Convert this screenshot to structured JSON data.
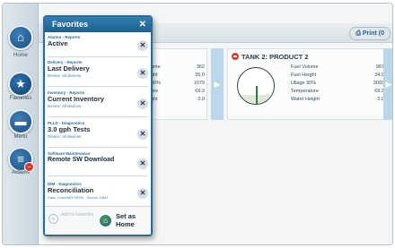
{
  "topbar": {
    "print_label": "⎙ Print (0"
  },
  "sidebar": {
    "items": [
      {
        "label": "Home"
      },
      {
        "label": "Favorites"
      },
      {
        "label": "Menu"
      },
      {
        "label": "Actions"
      }
    ]
  },
  "tank1": {
    "readings": [
      {
        "value": "362"
      },
      {
        "value": "35.0"
      },
      {
        "value": "1079"
      },
      {
        "value": "69.3"
      },
      {
        "value": "0.0"
      }
    ]
  },
  "tank2": {
    "title": "TANK 2: PRODUCT 2",
    "readings": [
      {
        "label": "Fuel Volume",
        "value": "987"
      },
      {
        "label": "Fuel Height",
        "value": "34.9"
      },
      {
        "label": "Ullage 90%",
        "value": "3093"
      },
      {
        "label": "Temperature",
        "value": "69.3"
      },
      {
        "label": "Water Height",
        "value": "0.0"
      }
    ]
  },
  "favorites": {
    "title": "Favorites",
    "close": "✕",
    "items": [
      {
        "category": "Alarms - Reports",
        "name": "Active",
        "sub": ""
      },
      {
        "category": "Delivery - Reports",
        "name": "Last Delivery",
        "sub": "Device: all devices"
      },
      {
        "category": "Inventory - Reports",
        "name": "Current Inventory",
        "sub": "Device: all devices"
      },
      {
        "category": "PLLD - Diagnostics",
        "name": "3.0 gph Tests",
        "sub": "Device: all devices"
      },
      {
        "category": "Software Maintenance",
        "name": "Remote SW Download",
        "sub": ""
      },
      {
        "category": "DIM - Diagnostics",
        "name": "Reconciliation",
        "sub": "Data: Current(R:S539) · Device: DIM1"
      }
    ],
    "remove_glyph": "✕",
    "add_to_favorites": "Add to Favorites",
    "set_as_home": "Set as Home"
  }
}
